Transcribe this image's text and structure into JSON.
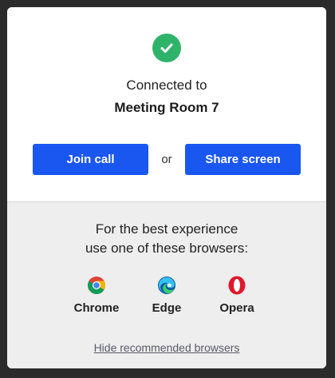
{
  "colors": {
    "accent": "#1a56f0",
    "success": "#2fb36b",
    "panel_bg": "#ffffff",
    "footer_bg": "#eeeeef"
  },
  "status": {
    "icon": "check-circle-icon",
    "line1": "Connected to",
    "room_name": "Meeting Room 7"
  },
  "actions": {
    "join_label": "Join call",
    "separator": "or",
    "share_label": "Share screen"
  },
  "recommendation": {
    "line1": "For the best experience",
    "line2": "use one of these browsers:",
    "browsers": [
      {
        "name": "Chrome",
        "icon": "chrome-icon"
      },
      {
        "name": "Edge",
        "icon": "edge-icon"
      },
      {
        "name": "Opera",
        "icon": "opera-icon"
      }
    ],
    "hide_link": "Hide recommended browsers"
  }
}
